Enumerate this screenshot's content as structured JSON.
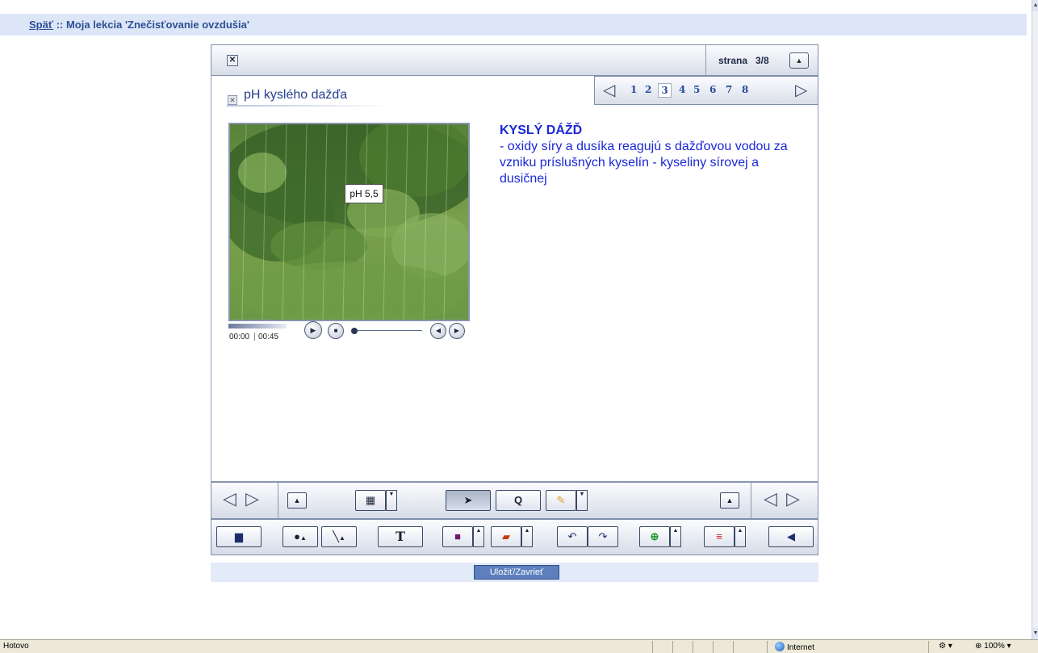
{
  "topbar": {
    "back_link": "Späť",
    "separator": " :: ",
    "title": "Moja lekcia 'Znečisťovanie ovzdušia'"
  },
  "header": {
    "close_icon": "close-box-icon",
    "page_label": "strana",
    "page_count": "3/8",
    "collapse_icon": "up-triangle-icon"
  },
  "pager": {
    "prev_icon": "left-triangle-icon",
    "next_icon": "right-triangle-icon",
    "pages": [
      "1",
      "2",
      "3",
      "4",
      "5",
      "6",
      "7",
      "8"
    ],
    "current": "3"
  },
  "slide": {
    "title": "pH kyslého dažďa",
    "tooltip": "pH 5,5",
    "video": {
      "time_current": "00:00",
      "time_total": "00:45"
    },
    "text": {
      "heading": "KYSLÝ DÁŽĎ",
      "body": "- oxidy síry a dusíka reagujú s dažďovou vodou za vzniku príslušných kyselín - kyseliny sírovej a dusičnej"
    }
  },
  "toolbar1": {
    "icons": [
      "left-triangle-icon",
      "right-triangle-icon",
      "up-triangle-icon",
      "calculator-icon",
      "pointer-icon",
      "magnifier-icon",
      "highlighter-icon",
      "up-triangle-icon",
      "left-triangle-icon",
      "right-triangle-icon"
    ]
  },
  "toolbar2": {
    "text_tool_label": "T",
    "icons": [
      "presentation-icon",
      "ink-drop-icon",
      "line-icon",
      "text-icon",
      "rectangle-icon",
      "eraser-icon",
      "undo-icon",
      "redo-icon",
      "zoom-in-icon",
      "list-add-icon",
      "speaker-icon"
    ]
  },
  "save_button": "Uložiť/Zavrieť",
  "statusbar": {
    "left": "Hotovo",
    "zone": "Internet",
    "zoom": "100%"
  },
  "colors": {
    "accent": "#2c4f94",
    "slide_text": "#1a28d6",
    "save_button": "#5d7fbd"
  }
}
